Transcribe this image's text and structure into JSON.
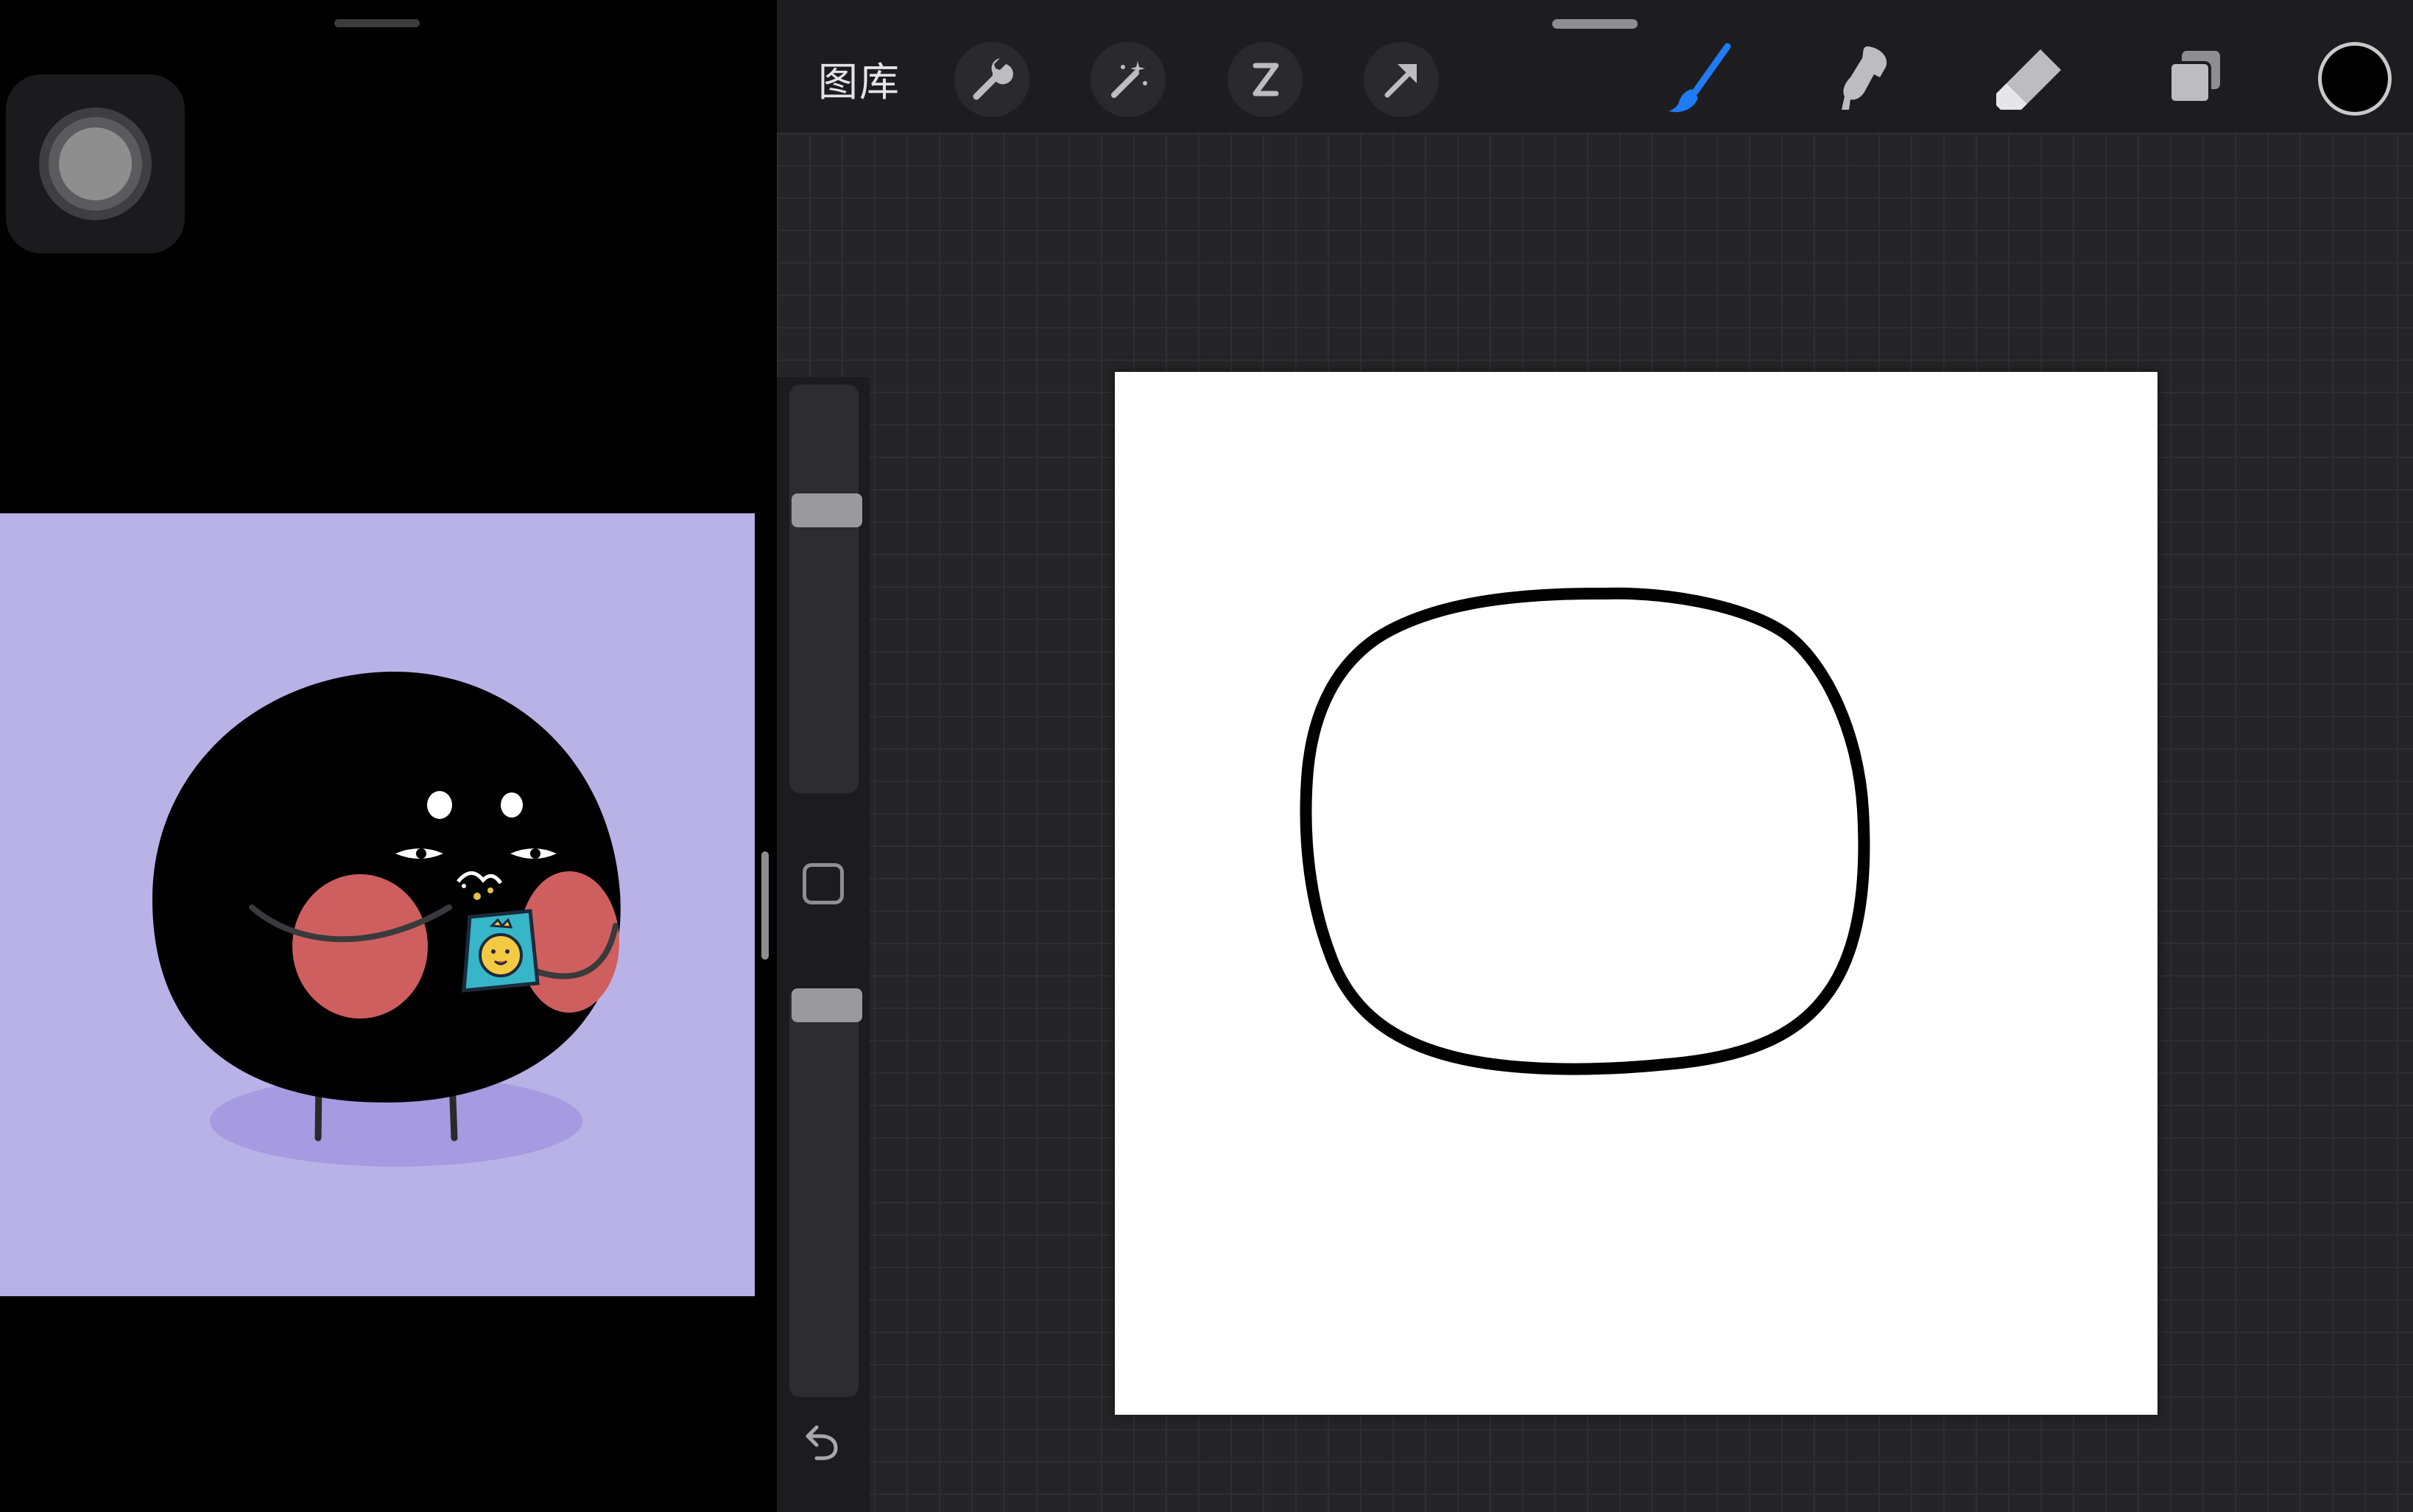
{
  "toolbar": {
    "gallery_label": "图库",
    "tools": [
      {
        "name": "actions",
        "icon": "wrench-icon"
      },
      {
        "name": "adjustments",
        "icon": "magic-wand-icon"
      },
      {
        "name": "selection",
        "icon": "selection-s-icon"
      },
      {
        "name": "transform",
        "icon": "transform-arrow-icon"
      },
      {
        "name": "paint",
        "icon": "brush-icon",
        "active": true,
        "active_color": "#1e7cf4"
      },
      {
        "name": "smudge",
        "icon": "smudge-finger-icon"
      },
      {
        "name": "erase",
        "icon": "eraser-icon"
      },
      {
        "name": "layers",
        "icon": "layers-icon"
      }
    ],
    "current_color": "#000000"
  },
  "sidebar": {
    "brush_size_level": 0.29,
    "opacity_level": 0.0,
    "modify_icon": "square-icon",
    "undo_icon": "undo-arrow-icon"
  },
  "canvas": {
    "background": "#ffffff",
    "stroke_color": "#000000"
  },
  "reference": {
    "background": "#b9b2e6",
    "character_color": "#000000",
    "cheek_color": "#cf5f5f",
    "shadow_color": "#a69ae0"
  },
  "system": {
    "assistive_touch_icon": "assistive-touch-icon"
  }
}
